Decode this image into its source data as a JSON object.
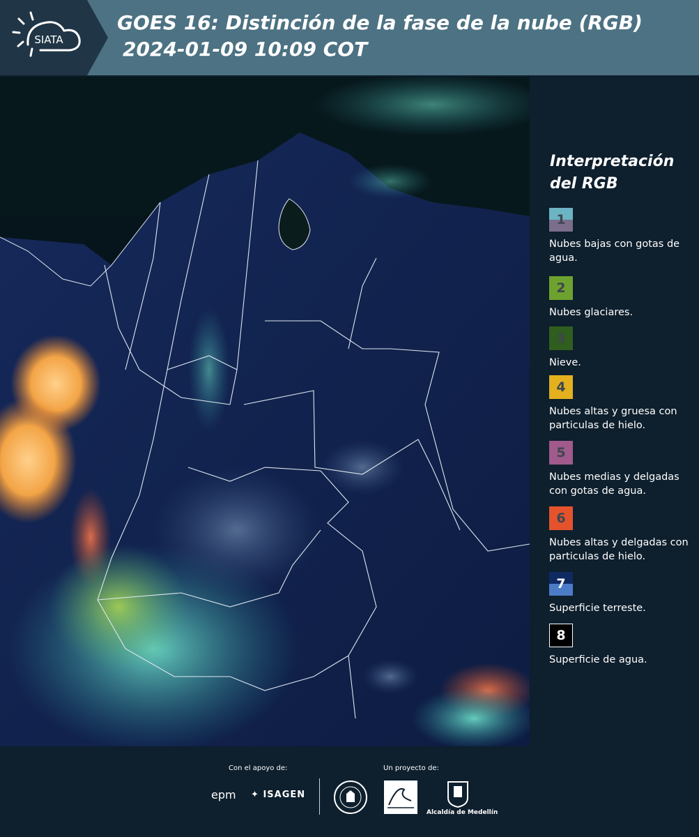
{
  "header": {
    "logo_text": "SIATA",
    "title_line1": "GOES 16: Distinción de la fase de la nube (RGB)",
    "title_line2": "2024-01-09 10:09 COT"
  },
  "legend": {
    "title": "Interpretación del RGB",
    "items": [
      {
        "number": "1",
        "label": "Nubes bajas con gotas de agua.",
        "color_top": "#6cb4c4",
        "color_bottom": "#7a6e8c"
      },
      {
        "number": "2",
        "label": "Nubes glaciares.",
        "color": "#6ea22f"
      },
      {
        "number": "3",
        "label": "Nieve.",
        "color": "#2f5e1e"
      },
      {
        "number": "4",
        "label": "Nubes altas y gruesa con particulas de hielo.",
        "color": "#e3b11e"
      },
      {
        "number": "5",
        "label": "Nubes medias y delgadas con gotas de agua.",
        "color": "#a05a8c"
      },
      {
        "number": "6",
        "label": "Nubes altas y delgadas con particulas de hielo.",
        "color": "#e4532c"
      },
      {
        "number": "7",
        "label": "Superficie terreste.",
        "color_top": "#0f2a63",
        "color_bottom": "#4c7cc8"
      },
      {
        "number": "8",
        "label": "Superficie de agua.",
        "color": "#000000"
      }
    ]
  },
  "footer": {
    "support_label": "Con el apoyo de:",
    "project_label": "Un proyecto de:",
    "epm": "epm",
    "isagen": "ISAGEN",
    "alcaldia": "Alcaldía de Medellín"
  }
}
